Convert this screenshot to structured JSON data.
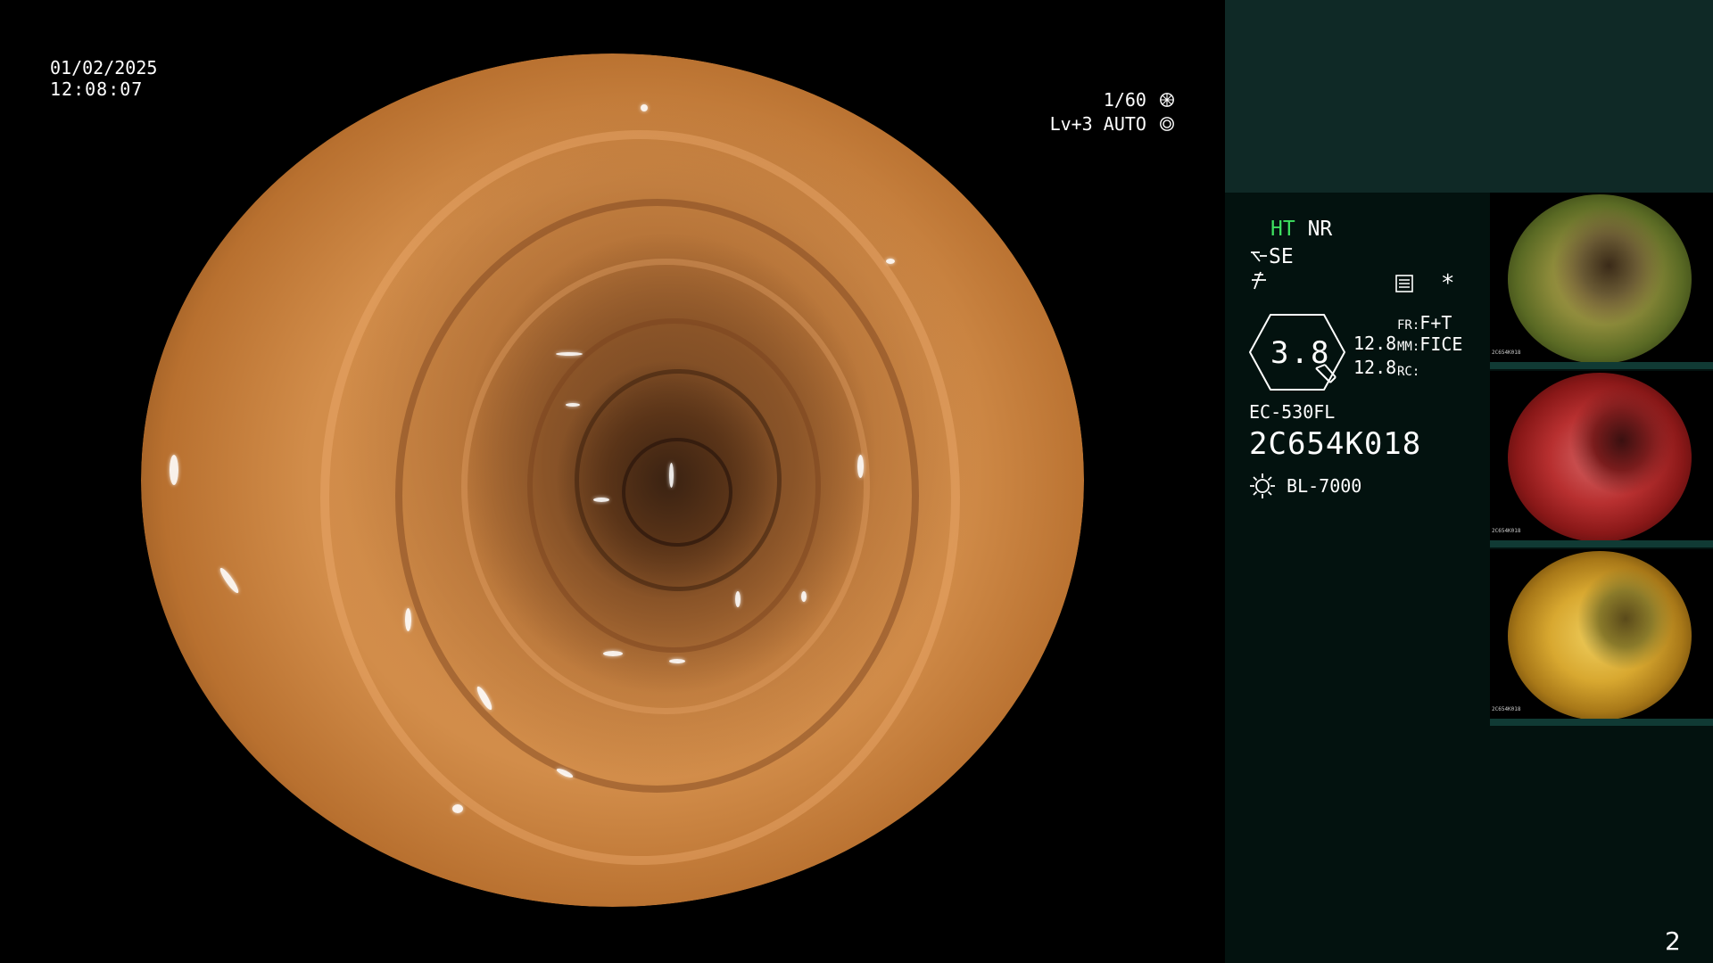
{
  "overlay": {
    "date": "01/02/2025",
    "time": "12:08:07",
    "shutter": "1/60",
    "level": "Lv+3",
    "mode": "AUTO"
  },
  "info": {
    "ht": "HT",
    "nr": "NR",
    "se": "SE",
    "dial_value": "3.8",
    "magnification_1": "12.8",
    "magnification_2": "12.8",
    "fr_label": "FR:",
    "fr_value": "F+T",
    "mm_label": "MM:",
    "mm_value": "FICE",
    "rc_label": "RC:",
    "asterisk": "*",
    "scope_model": "EC-530FL",
    "scope_serial": "2C654K018",
    "light_source": "BL-7000",
    "ht_color": "#3ee060"
  },
  "thumbnails": [
    {
      "caption": "2C654K018",
      "tone": "green-yellow"
    },
    {
      "caption": "2C654K018",
      "tone": "red"
    },
    {
      "caption": "2C654K018",
      "tone": "yellow"
    }
  ],
  "page_number": "2",
  "colors": {
    "panel_top": "#0f2926",
    "panel_bottom": "#03120f",
    "background": "#000000"
  }
}
